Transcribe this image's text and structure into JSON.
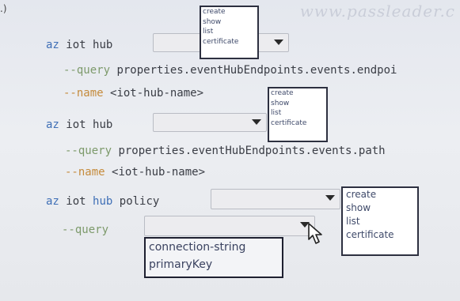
{
  "lead": ".)",
  "watermark": "www.passleader.c",
  "block1": {
    "az": "az",
    "cmd": "iot hub",
    "query_flag": "--query",
    "query_value": "properties.eventHubEndpoints.events.endpoi",
    "name_flag": "--name",
    "name_value": "<iot-hub-name>",
    "menu": [
      "create",
      "show",
      "list",
      "certificate"
    ]
  },
  "block2": {
    "az": "az",
    "cmd": "iot hub",
    "query_flag": "--query",
    "query_value": "properties.eventHubEndpoints.events.path",
    "name_flag": "--name",
    "name_value": "<iot-hub-name>",
    "menu": [
      "create",
      "show",
      "list",
      "certificate"
    ]
  },
  "block3": {
    "az": "az",
    "cmd_a": "iot",
    "cmd_b": "hub",
    "cmd_c": "policy",
    "query_flag": "--query",
    "menu": [
      "create",
      "show",
      "list",
      "certificate"
    ],
    "query_menu": [
      "connection-string",
      "primaryKey"
    ]
  },
  "icons": {
    "dropdown": "caret-down-icon",
    "pointer": "mouse-pointer-icon"
  }
}
